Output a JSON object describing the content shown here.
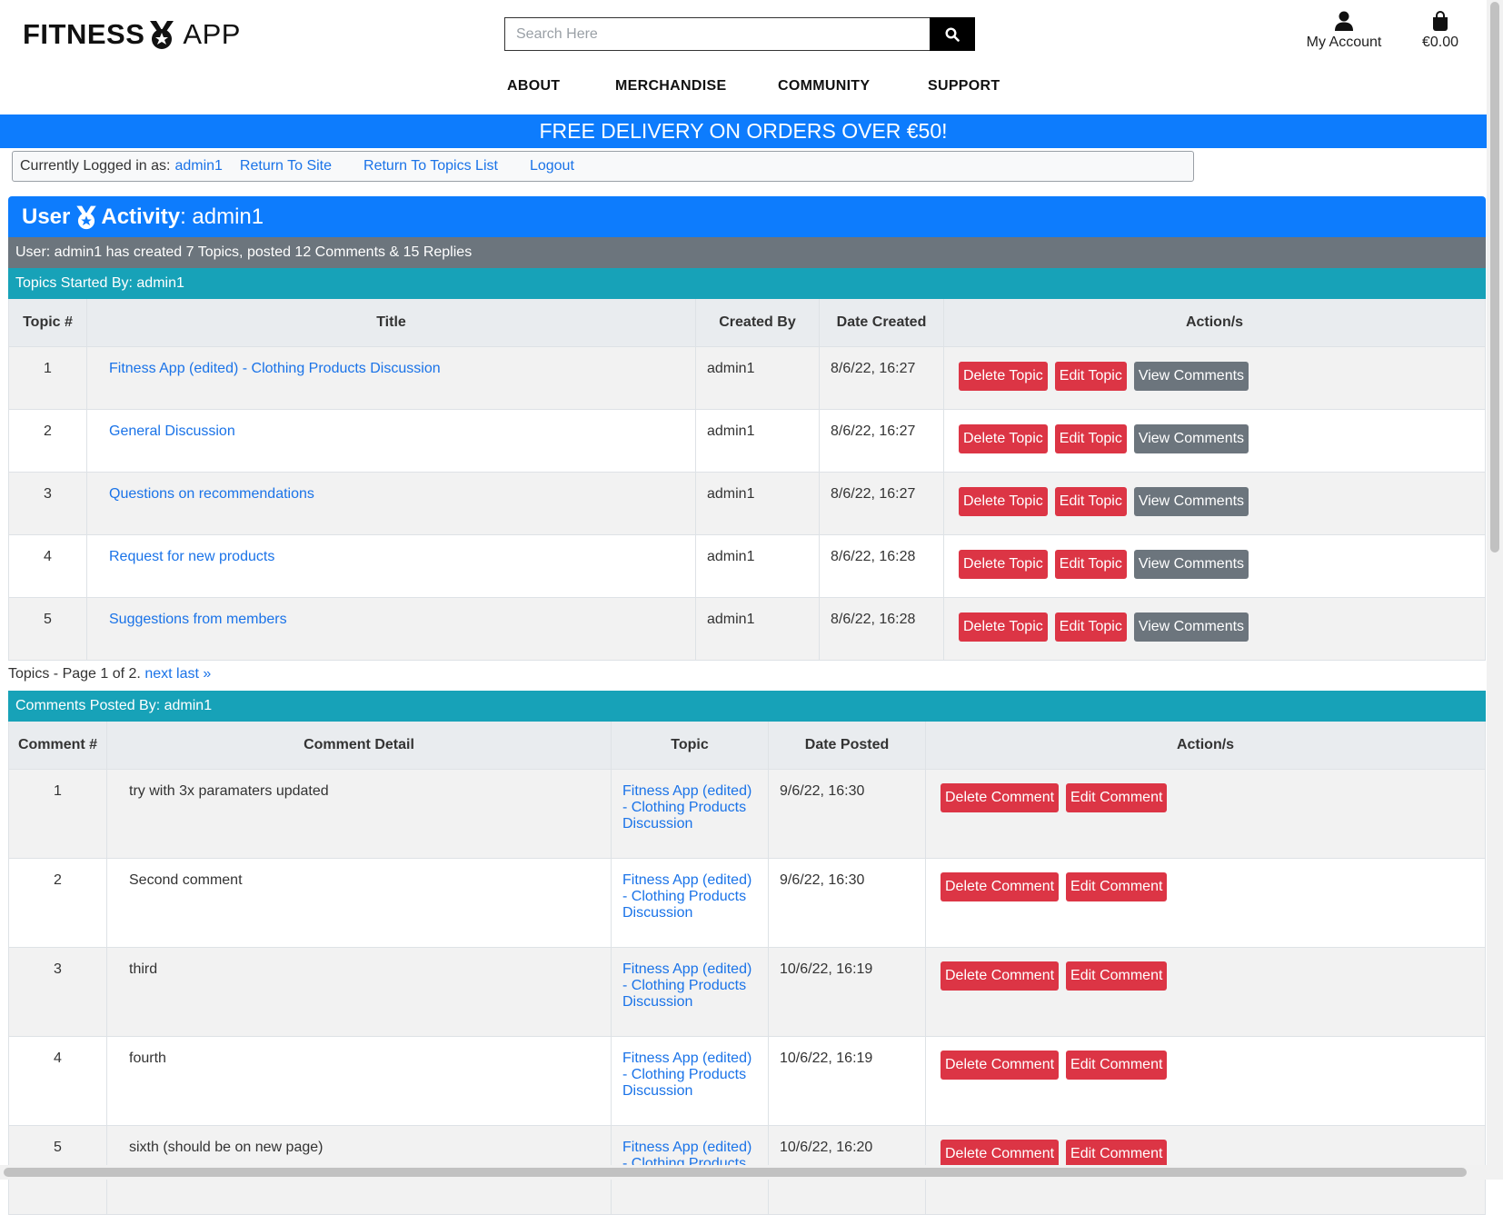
{
  "header": {
    "logo_left": "FITNESS",
    "logo_right": "APP",
    "search_placeholder": "Search Here",
    "account_label": "My Account",
    "bag_total": "€0.00"
  },
  "nav": {
    "items": [
      "ABOUT",
      "MERCHANDISE",
      "COMMUNITY",
      "SUPPORT"
    ]
  },
  "banner": "FREE DELIVERY ON ORDERS OVER €50!",
  "adminbar": {
    "label": "Currently Logged in as:",
    "user": "admin1",
    "links": [
      "Return To Site",
      "Return To Topics List",
      "Logout"
    ]
  },
  "page": {
    "title_a": "User",
    "title_b": "Activity",
    "title_name": ": admin1",
    "summary": "User: admin1 has created 7 Topics, posted 12 Comments & 15 Replies"
  },
  "topics": {
    "section_title": "Topics Started By: admin1",
    "headers": [
      "Topic #",
      "Title",
      "Created By",
      "Date Created",
      "Action/s"
    ],
    "rows": [
      {
        "num": "1",
        "title": "Fitness App (edited) - Clothing Products Discussion",
        "by": "admin1",
        "date": "8/6/22, 16:27"
      },
      {
        "num": "2",
        "title": "General Discussion",
        "by": "admin1",
        "date": "8/6/22, 16:27"
      },
      {
        "num": "3",
        "title": "Questions on recommendations",
        "by": "admin1",
        "date": "8/6/22, 16:27"
      },
      {
        "num": "4",
        "title": "Request for new products",
        "by": "admin1",
        "date": "8/6/22, 16:28"
      },
      {
        "num": "5",
        "title": "Suggestions from members",
        "by": "admin1",
        "date": "8/6/22, 16:28"
      }
    ],
    "btn_delete": "Delete Topic",
    "btn_edit": "Edit Topic",
    "btn_view": "View Comments",
    "pager_text": "Topics - Page 1 of 2.",
    "pager_next": "next",
    "pager_last": "last »"
  },
  "comments": {
    "section_title": "Comments Posted By: admin1",
    "headers": [
      "Comment #",
      "Comment Detail",
      "Topic",
      "Date Posted",
      "Action/s"
    ],
    "rows": [
      {
        "num": "1",
        "detail": "try with 3x paramaters updated",
        "topic": "Fitness App (edited) - Clothing Products Discussion",
        "date": "9/6/22, 16:30"
      },
      {
        "num": "2",
        "detail": "Second comment",
        "topic": "Fitness App (edited) - Clothing Products Discussion",
        "date": "9/6/22, 16:30"
      },
      {
        "num": "3",
        "detail": "third",
        "topic": "Fitness App (edited) - Clothing Products Discussion",
        "date": "10/6/22, 16:19"
      },
      {
        "num": "4",
        "detail": "fourth",
        "topic": "Fitness App (edited) - Clothing Products Discussion",
        "date": "10/6/22, 16:19"
      },
      {
        "num": "5",
        "detail": "sixth (should be on new page)",
        "topic": "Fitness App (edited) - Clothing Products",
        "date": "10/6/22, 16:20"
      }
    ],
    "btn_delete": "Delete Comment",
    "btn_edit": "Edit Comment"
  },
  "colors": {
    "primary": "#0d7cfd",
    "info": "#17a2b8",
    "secondary": "#6c757d",
    "danger": "#dc3545"
  }
}
